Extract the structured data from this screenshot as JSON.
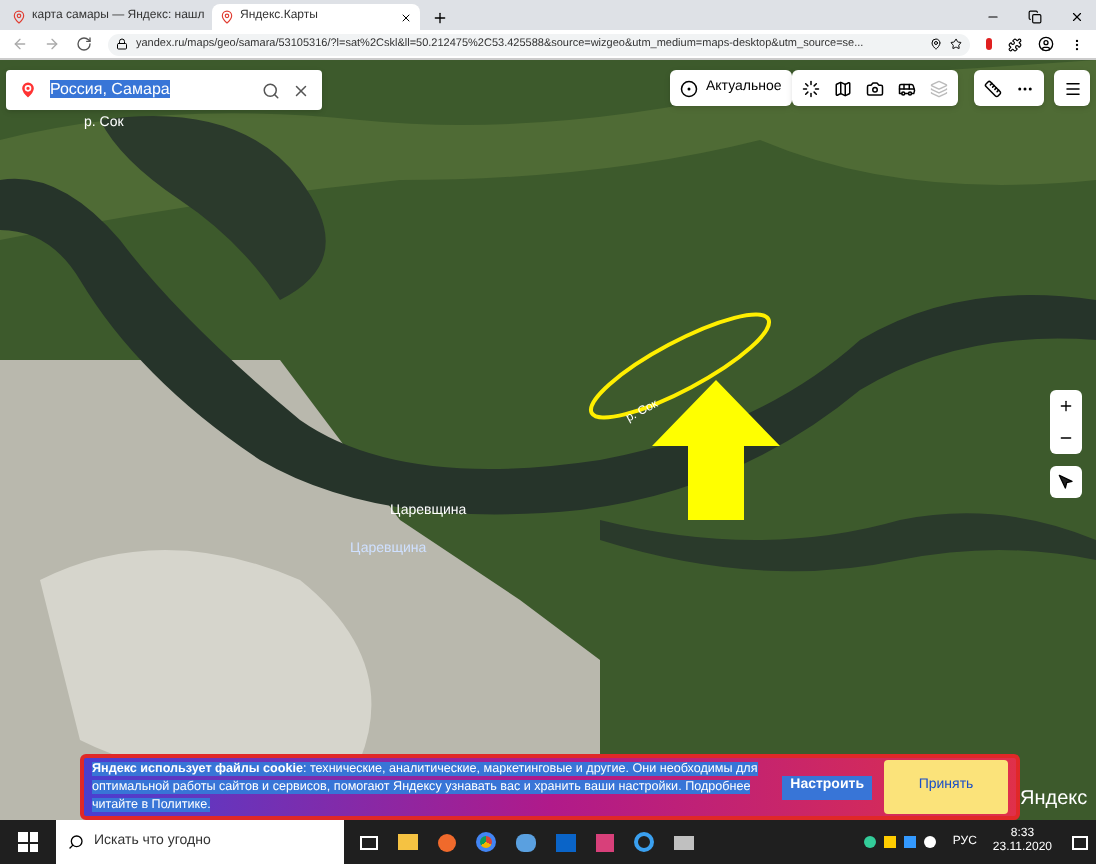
{
  "browser": {
    "tabs": [
      {
        "title": "карта самары — Яндекс: нашл",
        "selected": false
      },
      {
        "title": "Яндекс.Карты",
        "selected": true
      }
    ],
    "address": "yandex.ru/maps/geo/samara/53105316/?l=sat%2Cskl&ll=50.212475%2C53.425588&source=wizgeo&utm_medium=maps-desktop&utm_source=se..."
  },
  "search": {
    "value": "Россия, Самара",
    "text_selected": true
  },
  "layer_button": {
    "label": "Актуальное"
  },
  "map_labels": [
    {
      "text": "р. Сок",
      "kind": "river"
    },
    {
      "text": "р. Сок",
      "kind": "river_marked"
    },
    {
      "text": "Царевщина",
      "kind": "village"
    },
    {
      "text": "Царевщина",
      "kind": "station"
    }
  ],
  "cookie_banner": {
    "text": "**Яндекс использует файлы cookie**: технические, аналитические, маркетинговые и другие. Они необходимы для оптимальной работы сайтов и сервисов, помогают Яндексу узнавать вас и хранить ваши настройки. Подробнее читайте в Политике.",
    "text_selected": true,
    "buttons": [
      {
        "label": "Настроить",
        "kind": "link"
      },
      {
        "label": "Принять",
        "kind": "primary"
      }
    ]
  },
  "logo": "Яндекс",
  "taskbar": {
    "search_placeholder": "Искать что угодно",
    "language": "РУС",
    "time": "8:33",
    "date": "23.11.2020"
  }
}
